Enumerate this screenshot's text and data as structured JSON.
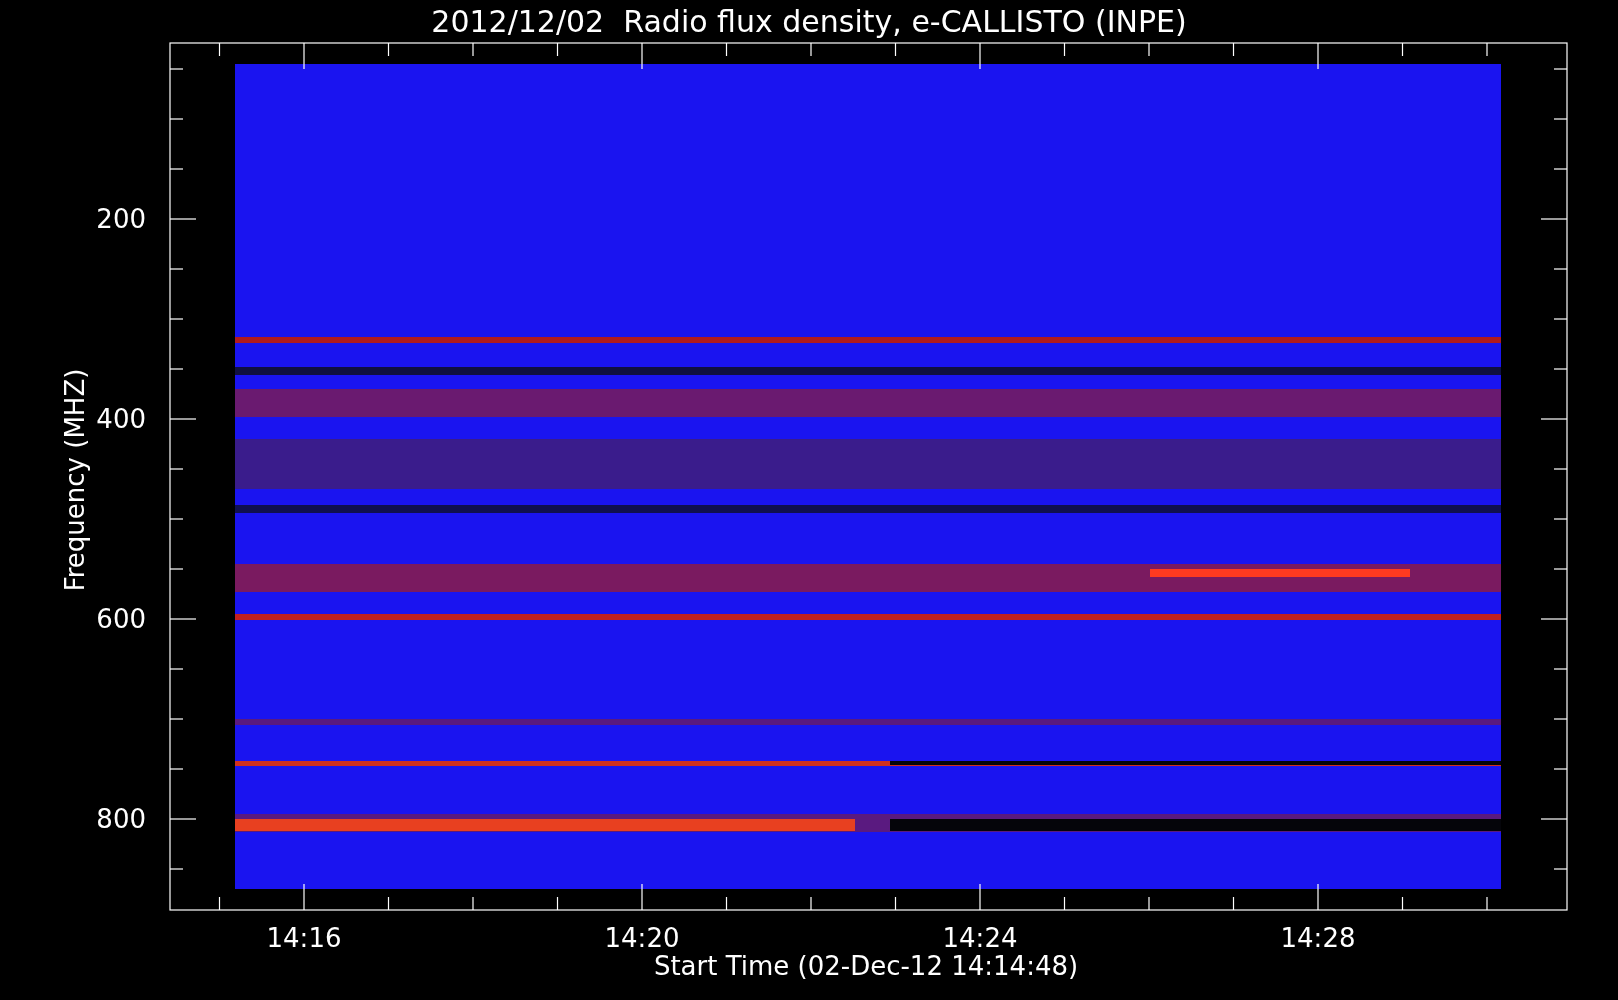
{
  "title": "2012/12/02  Radio flux density, e-CALLISTO (INPE)",
  "y_axis": {
    "label": "Frequency (MHZ)",
    "tick_labels": [
      "200",
      "400",
      "600",
      "800"
    ]
  },
  "x_axis": {
    "label": "Start Time (02-Dec-12 14:14:48)",
    "tick_labels": [
      "14:16",
      "14:20",
      "14:24",
      "14:28"
    ]
  }
}
